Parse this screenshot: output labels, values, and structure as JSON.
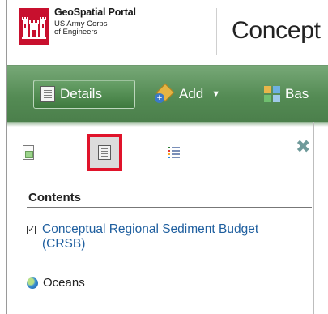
{
  "header": {
    "brand_title": "GeoSpatial Portal",
    "brand_line1": "US Army Corps",
    "brand_line2": "of Engineers",
    "page_title": "Concept"
  },
  "toolbar": {
    "details_label": "Details",
    "add_label": "Add",
    "basemap_label": "Bas"
  },
  "panel": {
    "contents_title": "Contents",
    "close_icon": "close-icon",
    "layers": [
      {
        "name": "Conceptual Regional Sediment Budget (CRSB)",
        "checked": true
      }
    ],
    "basemap": {
      "name": "Oceans"
    }
  },
  "colors": {
    "toolbar_green": "#548b54",
    "link_blue": "#1f5f9f",
    "highlight_red": "#e0132a",
    "logo_red": "#c8102e"
  }
}
